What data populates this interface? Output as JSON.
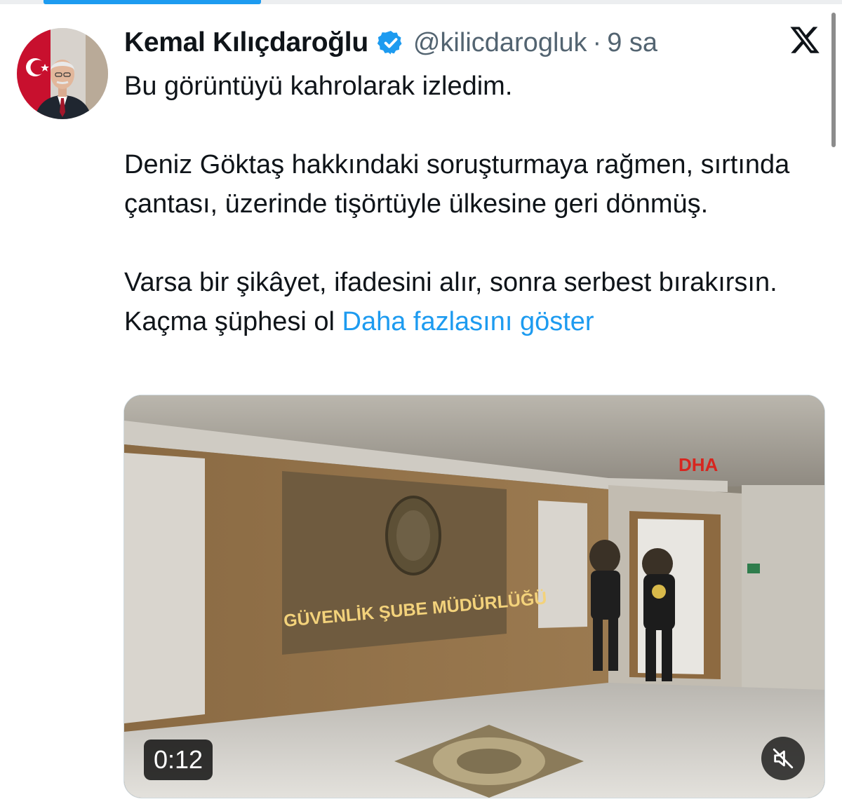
{
  "tweet": {
    "author_name": "Kemal Kılıçdaroğlu",
    "handle": "@kilicdarogluk",
    "separator": "·",
    "time_ago": "9 sa",
    "verified_icon": "verified-badge-icon",
    "text": {
      "line1": "Bu görüntüyü kahrolarak izledim.",
      "para2": "Deniz Göktaş hakkındaki soruşturmaya rağmen, sırtında çantası, üzerinde tişörtüyle ülkesine geri dönmüş.",
      "para3": "Varsa bir şikâyet, ifadesini alır, sonra serbest bırakırsın. Kaçma şüphesi ol",
      "show_more": "Daha fazlasını göster"
    }
  },
  "media": {
    "duration": "0:12",
    "watermark": "DHA",
    "wall_sign": "GÜVENLİK ŞUBE MÜDÜRLÜĞÜ",
    "mute_icon": "speaker-muted-icon"
  },
  "colors": {
    "link": "#1d9bf0",
    "secondary_text": "#536471",
    "primary_text": "#0f1419"
  }
}
